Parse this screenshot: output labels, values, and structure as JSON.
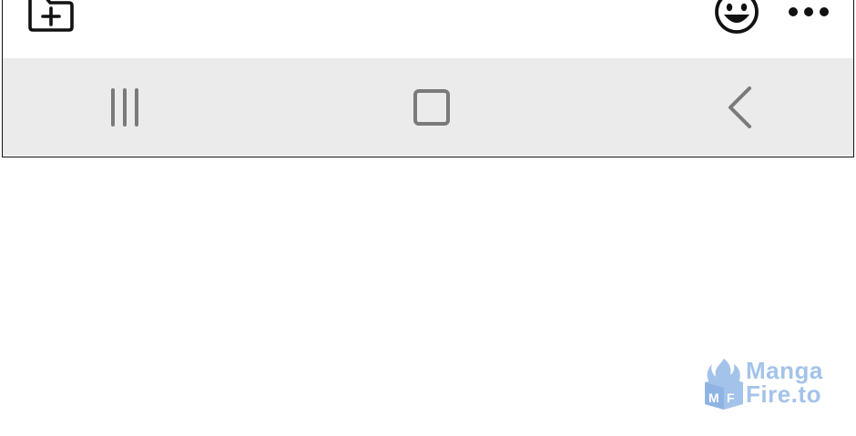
{
  "toolbar": {
    "left_icon": "add-folder-icon",
    "right_icons": [
      "smiley-icon",
      "more-options-icon"
    ]
  },
  "navbar": {
    "buttons": [
      {
        "name": "recent-apps",
        "icon": "recent-apps-icon"
      },
      {
        "name": "home",
        "icon": "home-icon"
      },
      {
        "name": "back",
        "icon": "back-icon"
      }
    ]
  },
  "watermark": {
    "line1": "Manga",
    "line2": "Fire.to",
    "color": "#a4c3ea"
  },
  "colors": {
    "navbar_bg": "#ebebeb",
    "frame_border": "#111111",
    "nav_icon": "#7a7a7a"
  }
}
